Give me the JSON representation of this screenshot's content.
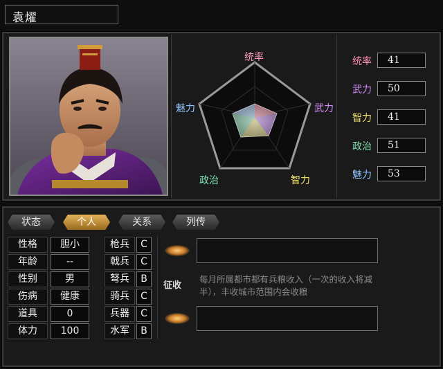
{
  "character": {
    "name": "袁燿"
  },
  "radar": {
    "labels": {
      "top": "统率",
      "right": "武力",
      "bottom_right": "智力",
      "bottom_left": "政治",
      "left": "魅力"
    },
    "label_colors": {
      "top": "#ff9ec0",
      "right": "#d68cff",
      "bottom_right": "#f3e26b",
      "bottom_left": "#7fe6b3",
      "left": "#8fc6ff"
    }
  },
  "stats": [
    {
      "label": "统率",
      "value": "41",
      "color": "#ff8fb0"
    },
    {
      "label": "武力",
      "value": "50",
      "color": "#d48aff"
    },
    {
      "label": "智力",
      "value": "41",
      "color": "#f0e06a"
    },
    {
      "label": "政治",
      "value": "51",
      "color": "#7fe0b0"
    },
    {
      "label": "魅力",
      "value": "53",
      "color": "#8fc2ff"
    }
  ],
  "tabs": [
    {
      "label": "状态",
      "active": false
    },
    {
      "label": "个人",
      "active": true
    },
    {
      "label": "关系",
      "active": false
    },
    {
      "label": "列传",
      "active": false
    }
  ],
  "personal": [
    {
      "label": "性格",
      "value": "胆小"
    },
    {
      "label": "年龄",
      "value": "--"
    },
    {
      "label": "性别",
      "value": "男"
    },
    {
      "label": "伤病",
      "value": "健康"
    },
    {
      "label": "道具",
      "value": "0"
    },
    {
      "label": "体力",
      "value": "100"
    }
  ],
  "aptitudes": [
    {
      "label": "枪兵",
      "value": "C"
    },
    {
      "label": "戟兵",
      "value": "C"
    },
    {
      "label": "弩兵",
      "value": "B"
    },
    {
      "label": "骑兵",
      "value": "C"
    },
    {
      "label": "兵器",
      "value": "C"
    },
    {
      "label": "水军",
      "value": "B"
    }
  ],
  "skills": {
    "name": "征收",
    "description": "每月所属都市都有兵粮收入（一次的收入将减半），丰收城市范围内会收粮"
  }
}
